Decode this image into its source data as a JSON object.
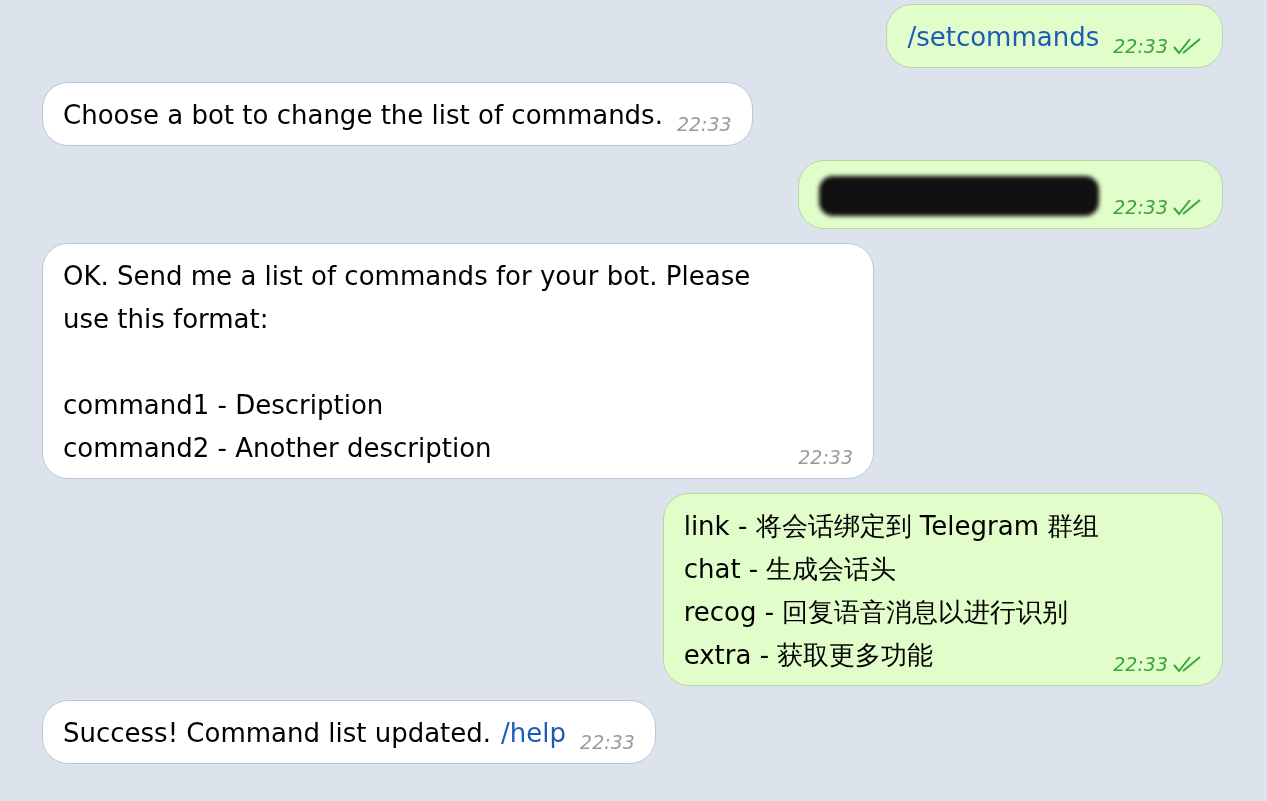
{
  "messages": [
    {
      "outgoing": true,
      "kind": "command",
      "paragraphs": [
        [
          "/setcommands"
        ]
      ],
      "time": "22:33",
      "read": true
    },
    {
      "outgoing": false,
      "kind": "text",
      "paragraphs": [
        [
          "Choose a bot to change the list of commands."
        ]
      ],
      "time": "22:33"
    },
    {
      "outgoing": true,
      "kind": "redacted",
      "time": "22:33",
      "read": true
    },
    {
      "outgoing": false,
      "kind": "text",
      "paragraphs": [
        [
          "OK. Send me a list of commands for your bot. Please use this format:"
        ],
        [
          "command1 - Description",
          "command2 - Another description"
        ]
      ],
      "time": "22:33"
    },
    {
      "outgoing": true,
      "kind": "text",
      "paragraphs": [
        [
          "link - 将会话绑定到 Telegram 群组",
          "chat - 生成会话头",
          "recog - 回复语音消息以进行识别",
          "extra - 获取更多功能"
        ]
      ],
      "time": "22:33",
      "read": true
    },
    {
      "outgoing": false,
      "kind": "text",
      "paragraphs": [
        [
          "Success! Command list updated."
        ]
      ],
      "link": "/help",
      "time": "22:33"
    }
  ]
}
